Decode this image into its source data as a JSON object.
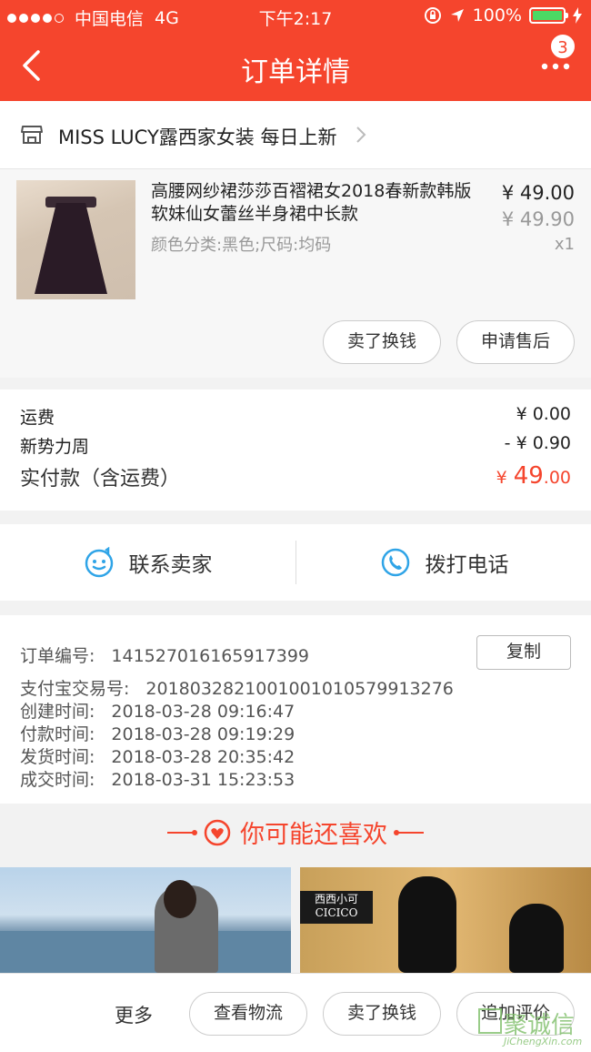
{
  "statusbar": {
    "carrier": "中国电信",
    "network": "4G",
    "time": "下午2:17",
    "battery": "100%"
  },
  "nav": {
    "title": "订单详情",
    "badge": "3"
  },
  "shop": {
    "name": "MISS LUCY露西家女装 每日上新"
  },
  "product": {
    "name": "高腰网纱裙莎莎百褶裙女2018春新款韩版软妹仙女蕾丝半身裙中长款",
    "spec": "颜色分类:黑色;尺码:均码",
    "price": "¥ 49.00",
    "original_price": "¥ 49.90",
    "qty": "x1",
    "btn_resell": "卖了换钱",
    "btn_aftersale": "申请售后"
  },
  "fees": {
    "shipping_label": "运费",
    "shipping_value": "¥ 0.00",
    "discount_label": "新势力周",
    "discount_value": "- ¥ 0.90",
    "total_label": "实付款（含运费）",
    "total_currency": "¥",
    "total_int": "49",
    "total_dec": ".00"
  },
  "contact": {
    "seller": "联系卖家",
    "phone": "拨打电话"
  },
  "order": {
    "copy": "复制",
    "rows": [
      {
        "label": "订单编号:",
        "value": "141527016165917399"
      },
      {
        "label": "支付宝交易号:",
        "value": "2018032821001001010579913276"
      },
      {
        "label": "创建时间:",
        "value": "2018-03-28 09:16:47"
      },
      {
        "label": "付款时间:",
        "value": "2018-03-28 09:19:29"
      },
      {
        "label": "发货时间:",
        "value": "2018-03-28 20:35:42"
      },
      {
        "label": "成交时间:",
        "value": "2018-03-31 15:23:53"
      }
    ]
  },
  "recommend": {
    "title": "你可能还喜欢",
    "brand": "西西小可 CICICO"
  },
  "bottom": {
    "more": "更多",
    "logistics": "查看物流",
    "resell": "卖了换钱",
    "review": "追加评价"
  },
  "watermark": {
    "text": "聚诚信",
    "sub": "JiChengXin.com"
  },
  "colors": {
    "accent": "#f5452d",
    "icon_blue": "#2fa4e7"
  }
}
